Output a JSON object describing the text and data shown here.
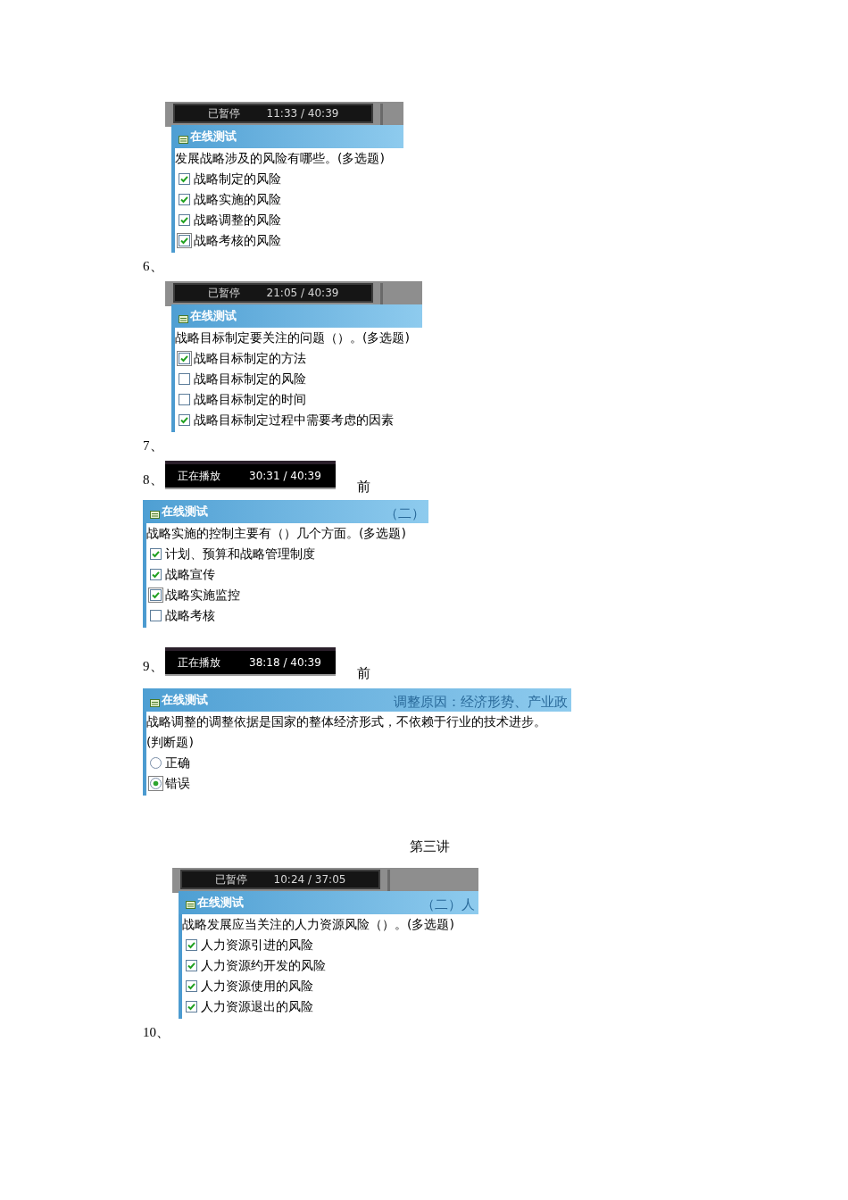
{
  "blocks": [
    {
      "kind": "screenshot",
      "player": {
        "status": "已暂停",
        "time": "11:33 / 40:39"
      },
      "quiz": {
        "title": "在线测试",
        "question": "发展战略涉及的风险有哪些。(多选题)",
        "options": [
          {
            "kind": "checkbox",
            "label": "战略制定的风险",
            "checked": true,
            "focused": false
          },
          {
            "kind": "checkbox",
            "label": "战略实施的风险",
            "checked": true,
            "focused": false
          },
          {
            "kind": "checkbox",
            "label": "战略调整的风险",
            "checked": true,
            "focused": false
          },
          {
            "kind": "checkbox",
            "label": "战略考核的风险",
            "checked": true,
            "focused": true
          }
        ]
      }
    },
    {
      "kind": "number",
      "text": "6、"
    },
    {
      "kind": "screenshot",
      "player": {
        "status": "已暂停",
        "time": "21:05 / 40:39"
      },
      "quiz": {
        "title": "在线测试",
        "question": "战略目标制定要关注的问题（）。(多选题)",
        "options": [
          {
            "kind": "checkbox",
            "label": "战略目标制定的方法",
            "checked": true,
            "focused": true
          },
          {
            "kind": "checkbox",
            "label": "战略目标制定的风险",
            "checked": false,
            "focused": false
          },
          {
            "kind": "checkbox",
            "label": "战略目标制定的时间",
            "checked": false,
            "focused": false
          },
          {
            "kind": "checkbox",
            "label": "战略目标制定过程中需要考虑的因素",
            "checked": true,
            "focused": false
          }
        ]
      }
    },
    {
      "kind": "number",
      "text": "7、"
    },
    {
      "kind": "player_row",
      "number": "8、",
      "player": {
        "status": "正在播放",
        "time": "30:31 / 40:39"
      },
      "note": "前"
    },
    {
      "kind": "screenshot",
      "quiz": {
        "title": "在线测试",
        "background_text": "（二）",
        "question": "战略实施的控制主要有（）几个方面。(多选题)",
        "options": [
          {
            "kind": "checkbox",
            "label": "计划、预算和战略管理制度",
            "checked": true,
            "focused": false
          },
          {
            "kind": "checkbox",
            "label": "战略宣传",
            "checked": true,
            "focused": false
          },
          {
            "kind": "checkbox",
            "label": "战略实施监控",
            "checked": true,
            "focused": true
          },
          {
            "kind": "checkbox",
            "label": "战略考核",
            "checked": false,
            "focused": false
          }
        ]
      }
    },
    {
      "kind": "player_row",
      "number": "9、",
      "player": {
        "status": "正在播放",
        "time": "38:18 / 40:39"
      },
      "note": "前"
    },
    {
      "kind": "screenshot",
      "quiz": {
        "title": "在线测试",
        "background_text": "调整原因：经济形势、产业政",
        "question": "战略调整的调整依据是国家的整体经济形式，不依赖于行业的技术进步。(判断题)",
        "options": [
          {
            "kind": "radio",
            "label": "正确",
            "checked": false,
            "focused": false
          },
          {
            "kind": "radio",
            "label": "错误",
            "checked": true,
            "focused": true
          }
        ]
      }
    },
    {
      "kind": "heading",
      "text": "第三讲"
    },
    {
      "kind": "screenshot",
      "player": {
        "status": "已暂停",
        "time": "10:24 / 37:05"
      },
      "quiz": {
        "title": "在线测试",
        "background_text": "（二）人",
        "question": "战略发展应当关注的人力资源风险（）。(多选题)",
        "options": [
          {
            "kind": "checkbox",
            "label": "人力资源引进的风险",
            "checked": true,
            "focused": false
          },
          {
            "kind": "checkbox",
            "label": "人力资源约开发的风险",
            "checked": true,
            "focused": false
          },
          {
            "kind": "checkbox",
            "label": "人力资源使用的风险",
            "checked": true,
            "focused": false
          },
          {
            "kind": "checkbox",
            "label": "人力资源退出的风险",
            "checked": true,
            "focused": false
          }
        ]
      }
    },
    {
      "kind": "number",
      "text": "10、"
    }
  ]
}
